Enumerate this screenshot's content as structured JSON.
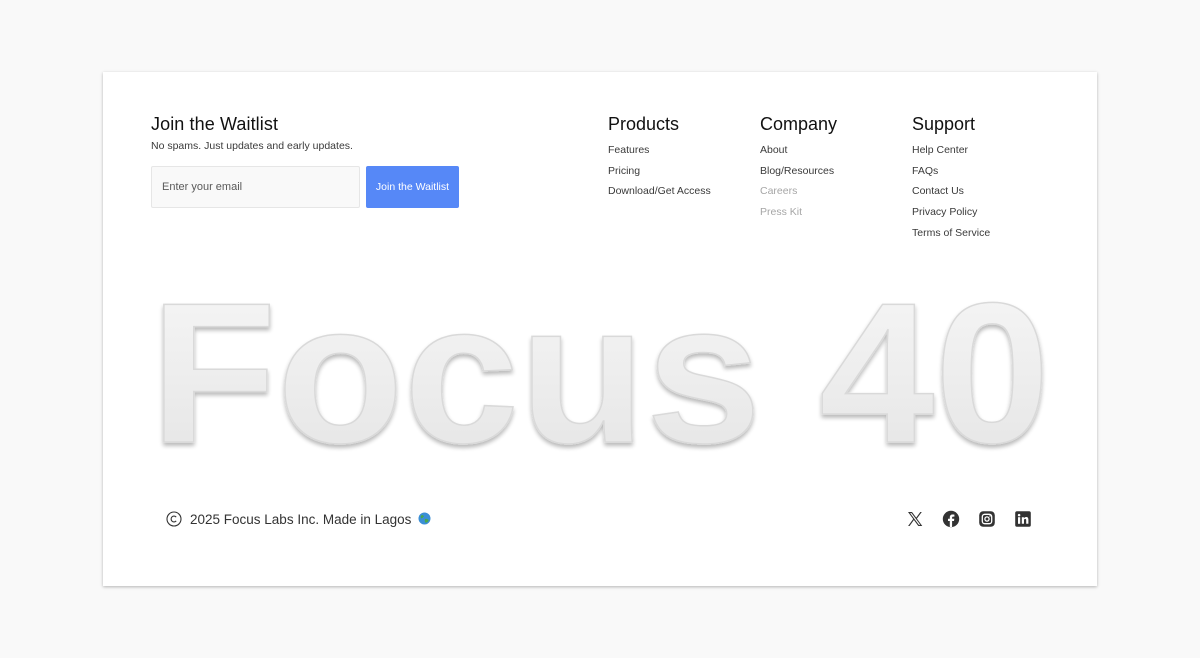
{
  "waitlist": {
    "title": "Join the Waitlist",
    "subtitle": "No spams. Just updates and early updates.",
    "email_placeholder": "Enter your email",
    "button_label": "Join the Waitlist"
  },
  "columns": {
    "products": {
      "title": "Products",
      "links": [
        "Features",
        "Pricing",
        "Download/Get Access"
      ]
    },
    "company": {
      "title": "Company",
      "links": [
        "About",
        "Blog/Resources",
        "Careers",
        "Press Kit"
      ]
    },
    "support": {
      "title": "Support",
      "links": [
        "Help Center",
        "FAQs",
        "Contact Us",
        "Privacy Policy",
        "Terms of Service"
      ]
    }
  },
  "brand_wordmark": "Focus 40",
  "footer": {
    "copyright": "2025 Focus Labs Inc. Made in Lagos",
    "socials": [
      "x-icon",
      "facebook-icon",
      "instagram-icon",
      "linkedin-icon"
    ]
  },
  "colors": {
    "accent": "#5688f7",
    "muted_link": "#a6a6a6",
    "wordmark_fill": "#ededed"
  }
}
